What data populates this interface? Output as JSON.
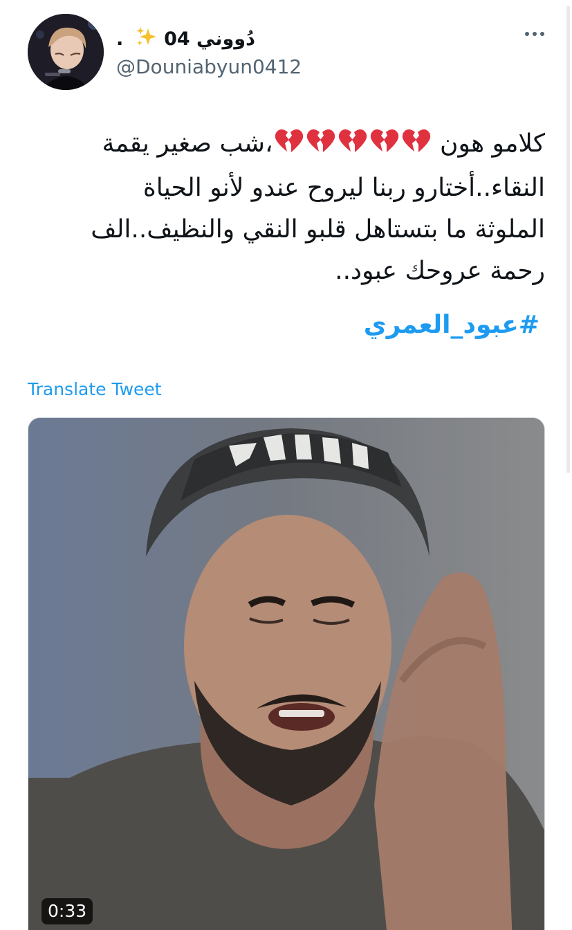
{
  "tweet": {
    "display_name": "دُووني 04",
    "display_name_suffix": ".",
    "handle": "@Douniabyun0412",
    "text_lines": [
      {
        "before": "كلامو هون",
        "hearts": 5,
        "after": "،شب صغير يقمة"
      },
      {
        "text": "النقاء..أختارو ربنا ليروح عندو لأنو الحياة"
      },
      {
        "text": "الملوثة ما بتستاهل قلبو النقي والنظيف..الف"
      },
      {
        "text": "رحمة عروحك عبود.."
      }
    ],
    "hashtag": "#عبود_العمري",
    "translate_label": "Translate Tweet",
    "video_duration": "0:33",
    "icons": {
      "sparkles": "sparkles-icon",
      "more": "more-options-icon",
      "broken_heart": "broken-heart-icon"
    },
    "colors": {
      "link": "#1d9bf0",
      "text": "#0f1419",
      "secondary": "#536471",
      "broken_heart": "#e0313f"
    }
  }
}
